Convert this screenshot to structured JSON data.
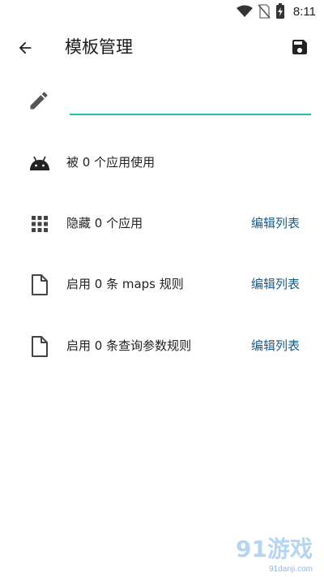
{
  "status_bar": {
    "time": "8:11",
    "icons": [
      "wifi-icon",
      "no-sim-icon",
      "battery-charging-icon"
    ]
  },
  "app_bar": {
    "title": "模板管理",
    "back_icon": "arrow-back-icon",
    "save_icon": "save-icon"
  },
  "name_field": {
    "value": "",
    "placeholder": "",
    "icon": "pencil-icon",
    "underline_color": "#26bfb5"
  },
  "rows": [
    {
      "icon": "android-icon",
      "label": "被 0 个应用使用",
      "action": ""
    },
    {
      "icon": "grid-icon",
      "label": "隐藏 0 个应用",
      "action": "编辑列表"
    },
    {
      "icon": "file-icon",
      "label": "启用 0 条 maps 规则",
      "action": "编辑列表"
    },
    {
      "icon": "file-icon",
      "label": "启用 0 条查询参数规则",
      "action": "编辑列表"
    }
  ],
  "watermark": {
    "brand": "91游戏",
    "url": "91danji.com"
  },
  "colors": {
    "accent": "#26bfb5",
    "link": "#1b5c8a",
    "icon": "#424242"
  }
}
